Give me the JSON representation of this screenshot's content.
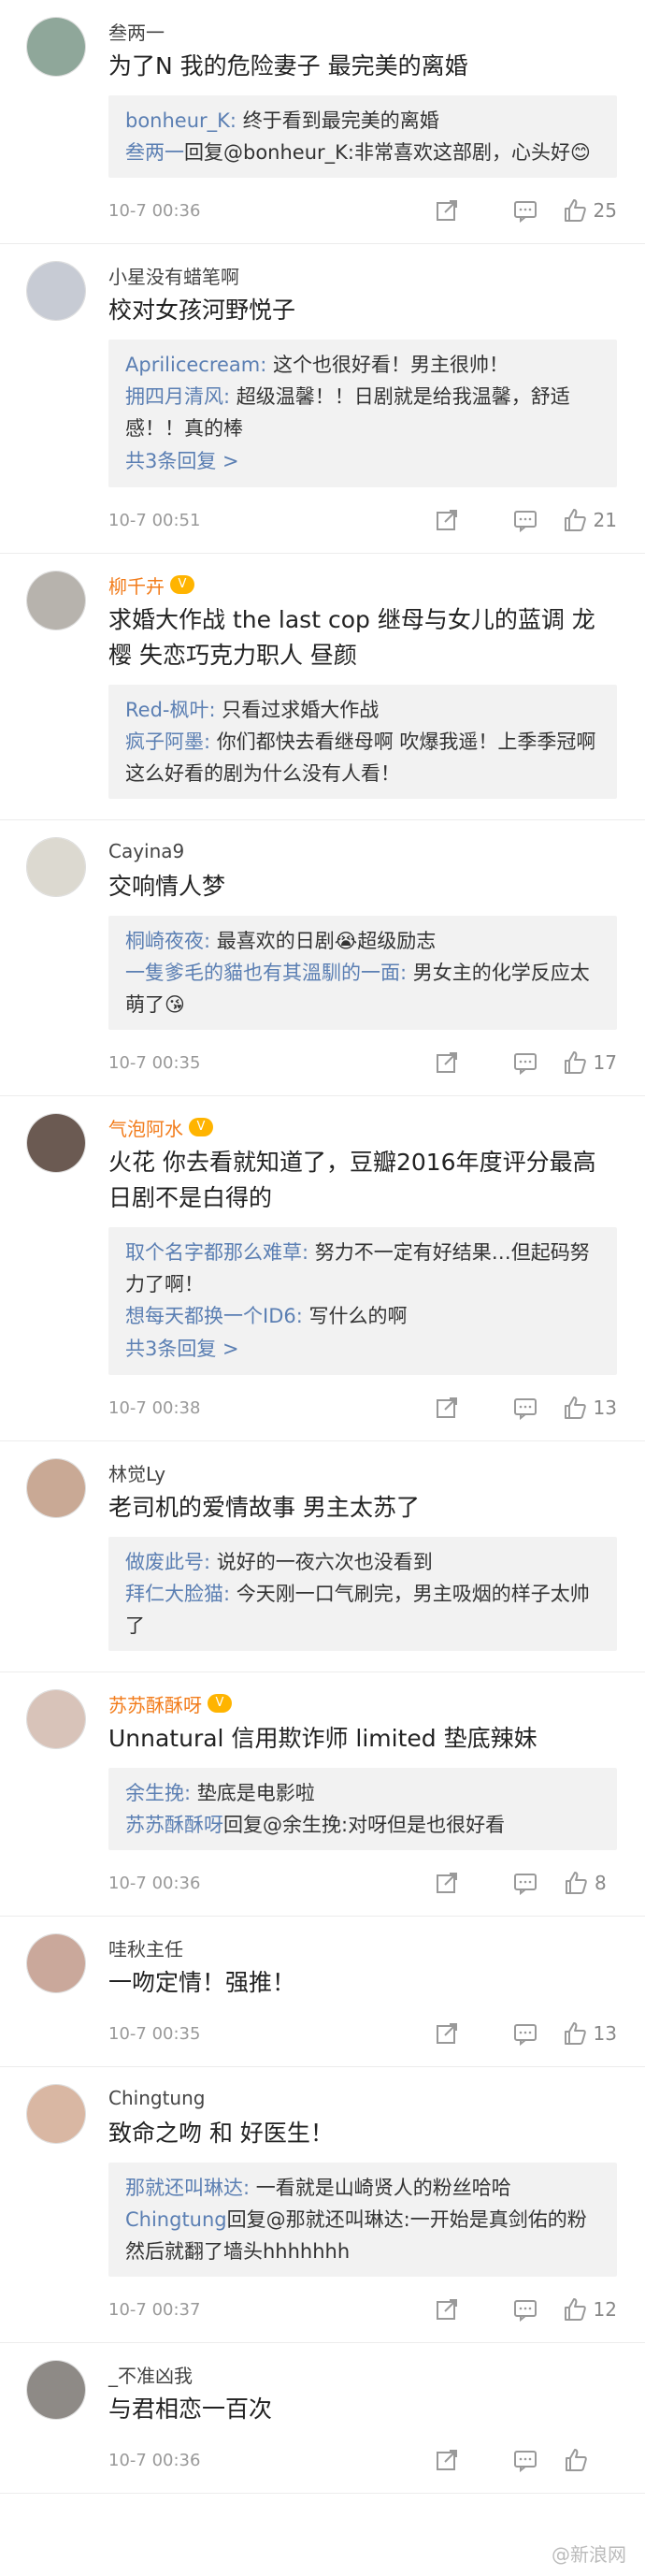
{
  "comments": [
    {
      "username": "叁两一",
      "vip": false,
      "text": "为了N 我的危险妻子 最完美的离婚",
      "replies": [
        {
          "name": "bonheur_K:",
          "text": " 终于看到最完美的离婚"
        },
        {
          "name": "叁两一",
          "text": "回复@bonheur_K:非常喜欢这部剧，心头好😊"
        }
      ],
      "more": "",
      "time": "10-7 00:36",
      "likes": "25",
      "avatar_color": "#8fa79a"
    },
    {
      "username": "小星没有蜡笔啊",
      "vip": false,
      "text": "校对女孩河野悦子",
      "replies": [
        {
          "name": "Aprilicecream:",
          "text": " 这个也很好看！男主很帅！"
        },
        {
          "name": "拥四月清风:",
          "text": " 超级温馨！！日剧就是给我温馨，舒适感！！真的棒"
        }
      ],
      "more": "共3条回复 >",
      "time": "10-7 00:51",
      "likes": "21",
      "avatar_color": "#c7cbd4"
    },
    {
      "username": "柳千卉",
      "vip": true,
      "text": "求婚大作战 the last cop 继母与女儿的蓝调 龙樱 失恋巧克力职人 昼颜",
      "replies": [
        {
          "name": "Red-枫叶:",
          "text": " 只看过求婚大作战"
        },
        {
          "name": "疯子阿墨:",
          "text": " 你们都快去看继母啊 吹爆我遥！上季季冠啊 这么好看的剧为什么没有人看！"
        }
      ],
      "more": "",
      "time": "",
      "likes": "",
      "avatar_color": "#b7b3ad"
    },
    {
      "username": "Cayina9",
      "vip": false,
      "text": "交响情人梦",
      "replies": [
        {
          "name": "桐崎夜夜:",
          "text": " 最喜欢的日剧😭超级励志"
        },
        {
          "name": "一隻爹毛的貓也有其溫馴的一面:",
          "text": " 男女主的化学反应太萌了😘"
        }
      ],
      "more": "",
      "time": "10-7 00:35",
      "likes": "17",
      "avatar_color": "#dcd9d0"
    },
    {
      "username": "气泡阿水",
      "vip": true,
      "text": "火花 你去看就知道了，豆瓣2016年度评分最高日剧不是白得的",
      "replies": [
        {
          "name": "取个名字都那么难草:",
          "text": " 努力不一定有好结果…但起码努力了啊！"
        },
        {
          "name": "想每天都换一个ID6:",
          "text": " 写什么的啊"
        }
      ],
      "more": "共3条回复 >",
      "time": "10-7 00:38",
      "likes": "13",
      "avatar_color": "#6b5a52"
    },
    {
      "username": "林觉Ly",
      "vip": false,
      "text": "老司机的爱情故事 男主太苏了",
      "replies": [
        {
          "name": "做废此号:",
          "text": " 说好的一夜六次也没看到"
        },
        {
          "name": "拜仁大脸猫:",
          "text": " 今天刚一口气刷完，男主吸烟的样子太帅了"
        }
      ],
      "more": "",
      "time": "",
      "likes": "",
      "avatar_color": "#c9a995"
    },
    {
      "username": "苏苏酥酥呀",
      "vip": true,
      "text": "Unnatural 信用欺诈师 limited 垫底辣妹",
      "replies": [
        {
          "name": "余生挽:",
          "text": " 垫底是电影啦"
        },
        {
          "name": "苏苏酥酥呀",
          "text": "回复@余生挽:对呀但是也很好看"
        }
      ],
      "more": "",
      "time": "10-7 00:36",
      "likes": "8",
      "avatar_color": "#d8c3b9"
    },
    {
      "username": "哇秋主任",
      "vip": false,
      "text": "一吻定情！强推！",
      "replies": [],
      "more": "",
      "time": "10-7 00:35",
      "likes": "13",
      "avatar_color": "#caa89b"
    },
    {
      "username": "Chingtung",
      "vip": false,
      "text": "致命之吻 和 好医生！",
      "replies": [
        {
          "name": "那就还叫琳达:",
          "text": " 一看就是山崎贤人的粉丝哈哈"
        },
        {
          "name": "Chingtung",
          "text": "回复@那就还叫琳达:一开始是真剑佑的粉 然后就翻了墙头hhhhhhh"
        }
      ],
      "more": "",
      "time": "10-7 00:37",
      "likes": "12",
      "avatar_color": "#d9b7a3"
    },
    {
      "username": "_不准凶我",
      "vip": false,
      "text": "与君相恋一百次",
      "replies": [],
      "more": "",
      "time": "10-7 00:36",
      "likes": "",
      "avatar_color": "#8e8a86"
    }
  ],
  "watermark": "@新浪网"
}
